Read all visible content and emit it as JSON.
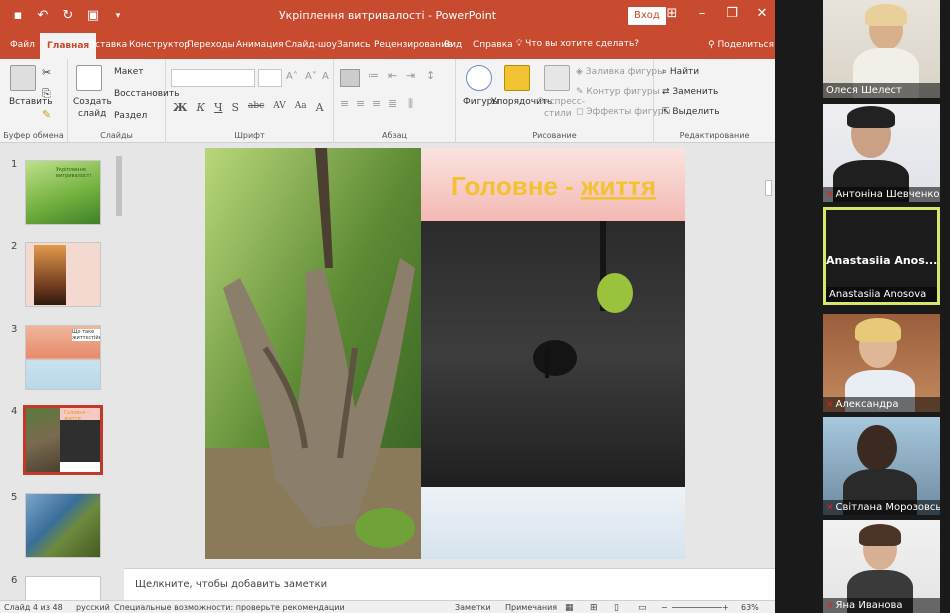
{
  "window": {
    "title": "Укріплення витривалості  -  PowerPoint",
    "signin_label": "Вход",
    "accent": "#c84b30"
  },
  "quick_access": {
    "icons": [
      "save-icon",
      "undo-icon",
      "redo-icon",
      "start-from-beginning-icon"
    ]
  },
  "tabs": [
    "Файл",
    "Главная",
    "Вставка",
    "Конструктор",
    "Переходы",
    "Анимация",
    "Слайд-шоу",
    "Запись",
    "Рецензирование",
    "Вид",
    "Справка"
  ],
  "active_tab": "Главная",
  "tell_me": "Что вы хотите сделать?",
  "share_label": "Поделиться",
  "ribbon": {
    "clipboard": {
      "paste": "Вставить",
      "label": "Буфер обмена"
    },
    "slides": {
      "new_slide_1": "Создать",
      "new_slide_2": "слайд",
      "layout": "Макет",
      "reset": "Восстановить",
      "section": "Раздел",
      "label": "Слайды"
    },
    "font": {
      "label": "Шрифт",
      "bold": "Ж",
      "italic": "К",
      "underline": "Ч",
      "shadow": "S",
      "strike": "abc",
      "spacing": "AV",
      "case": "Aa",
      "color": "A"
    },
    "paragraph": {
      "label": "Абзац"
    },
    "drawing": {
      "shapes": "Фигуры",
      "arrange": "Упорядочить",
      "quick_styles_1": "Экспресс-",
      "quick_styles_2": "стили",
      "fill": "Заливка фигуры",
      "outline": "Контур фигуры",
      "effects": "Эффекты фигуры",
      "label": "Рисование"
    },
    "editing": {
      "find": "Найти",
      "replace": "Заменить",
      "select": "Выделить",
      "label": "Редактирование"
    }
  },
  "thumbnails": [
    {
      "num": "1",
      "text": "Укріплення витривалості"
    },
    {
      "num": "2",
      "text": ""
    },
    {
      "num": "3",
      "text": "Що таке життєстійкість?"
    },
    {
      "num": "4",
      "text": "Головне - життя"
    },
    {
      "num": "5",
      "text": ""
    },
    {
      "num": "6",
      "text": ""
    }
  ],
  "selected_slide": "4",
  "slide": {
    "title_plain": "Головне - ",
    "title_emph": "життя",
    "title_color": "#f2c230"
  },
  "notes_placeholder": "Щелкните, чтобы добавить заметки",
  "status": {
    "slide_info": "Слайд 4 из 48",
    "language": "русский",
    "accessibility": "Специальные возможности: проверьте рекомендации",
    "notes": "Заметки",
    "comments": "Примечания",
    "zoom": "63%"
  },
  "participants": [
    {
      "name": "Олеся Шелест",
      "muted": false,
      "video": true
    },
    {
      "name": "Антоніна Шевченко",
      "muted": true,
      "video": true
    },
    {
      "name": "Anastasiia  Anosova",
      "display": "Anastasiia  Anos...",
      "muted": false,
      "video": false,
      "active": true,
      "active_color": "#d8e66a"
    },
    {
      "name": "Александра",
      "muted": true,
      "video": true
    },
    {
      "name": "Світлана Морозовсь...",
      "muted": true,
      "video": true
    },
    {
      "name": "Яна Иванова",
      "muted": true,
      "video": true
    }
  ]
}
